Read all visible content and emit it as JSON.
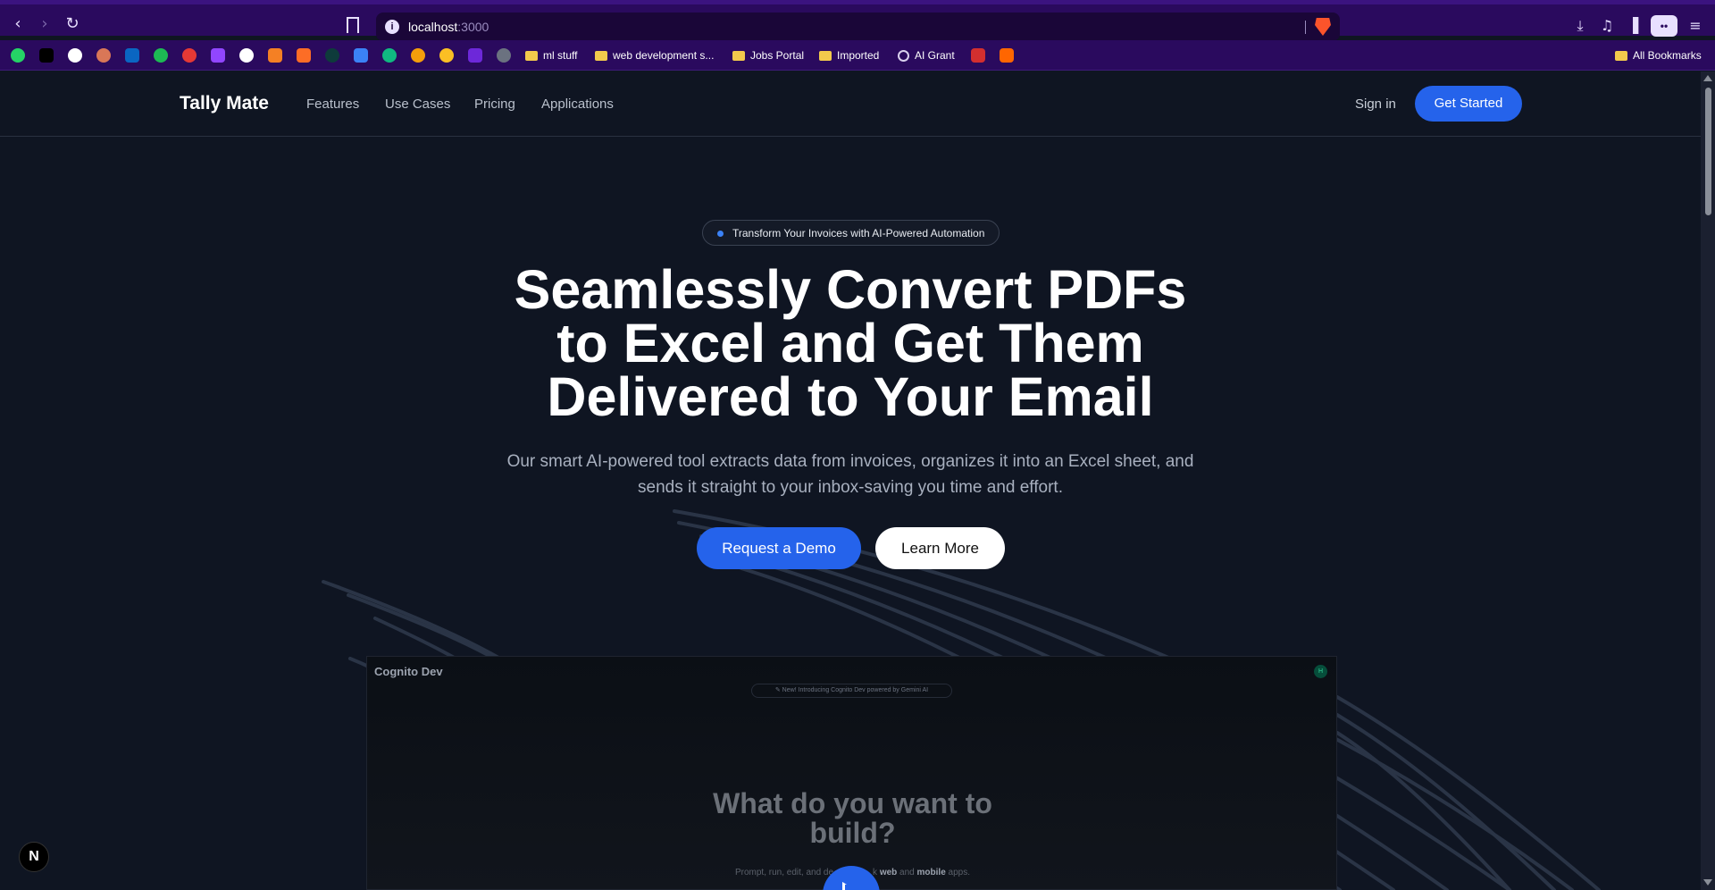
{
  "browser": {
    "url_host": "localhost",
    "url_port": ":3000",
    "bookmarks": {
      "folders": [
        {
          "label": "ml stuff"
        },
        {
          "label": "web development s..."
        },
        {
          "label": "Jobs Portal"
        },
        {
          "label": "Imported"
        },
        {
          "label": "AI Grant"
        }
      ],
      "all_label": "All Bookmarks"
    },
    "ext_label": "••"
  },
  "header": {
    "brand": "Tally Mate",
    "nav": [
      "Features",
      "Use Cases",
      "Pricing",
      "Applications"
    ],
    "signin": "Sign in",
    "cta": "Get Started"
  },
  "hero": {
    "badge": "Transform Your Invoices with AI-Powered Automation",
    "title_lines": [
      "Seamlessly Convert PDFs",
      "to Excel and Get Them",
      "Delivered to Your Email"
    ],
    "subtitle_lines": [
      "Our smart AI-powered tool extracts data from invoices, organizes it into an Excel sheet, and",
      "sends it straight to your inbox-saving you time and effort."
    ],
    "primary_button": "Request a Demo",
    "secondary_button": "Learn More"
  },
  "preview": {
    "brand": "Cognito Dev",
    "pill": "✎ New! Introducing Cognito Dev powered by Gemini AI",
    "avatar": "H",
    "title_lines": [
      "What do you want to",
      "build?"
    ],
    "sub_prefix": "Prompt, run, edit, and de",
    "sub_mid": "k ",
    "sub_web": "web",
    "sub_and": " and ",
    "sub_mobile": "mobile",
    "sub_suffix": " apps."
  },
  "next_badge": "N",
  "colors": {
    "browser_chrome": "#2a0a5e",
    "page_bg": "#0f1522",
    "accent": "#2563eb"
  }
}
